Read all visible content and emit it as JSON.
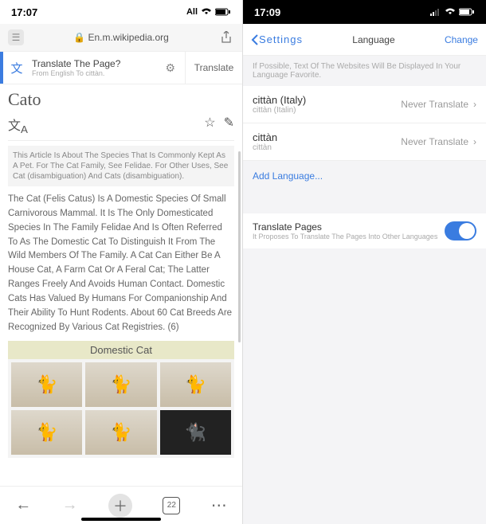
{
  "left": {
    "status": {
      "time": "17:07",
      "network": "All"
    },
    "address": {
      "lock": "🔒",
      "url": "En.m.wikipedia.org"
    },
    "translate_banner": {
      "title": "Translate The Page?",
      "subtitle": "From English To cittàn.",
      "button": "Translate"
    },
    "article": {
      "title": "Cato",
      "disambig": "This Article Is About The Species That Is Commonly Kept As A Pet. For The Cat Family, See Felidae. For Other Uses, See Cat (disambiguation) And Cats (disambiguation).",
      "body": "The Cat (Felis Catus) Is A Domestic Species Of Small Carnivorous Mammal. It Is The Only Domesticated Species In The Family Felidae And Is Often Referred To As The Domestic Cat To Distinguish It From The Wild Members Of The Family. A Cat Can Either Be A House Cat, A Farm Cat Or A Feral Cat; The Latter Ranges Freely And Avoids Human Contact. Domestic Cats Has Valued By Humans For Companionship And Their Ability To Hunt Rodents. About 60 Cat Breeds Are Recognized By Various Cat Registries. (6)",
      "infobox_header": "Domestic Cat"
    },
    "toolbar": {
      "tab_count": "22"
    }
  },
  "right": {
    "status": {
      "time": "17:09"
    },
    "nav": {
      "back": "Settings",
      "title": "Language",
      "change": "Change"
    },
    "description": "If Possible, Text Of The Websites Will Be Displayed In Your Language Favorite.",
    "languages": [
      {
        "name": "cittàn (Italy)",
        "sub": "cittàn (Italin)",
        "action": "Never Translate"
      },
      {
        "name": "cittàn",
        "sub": "cittàn",
        "action": "Never Translate"
      }
    ],
    "add_language": "Add Language...",
    "translate_pages": {
      "title": "Translate Pages",
      "subtitle": "It Proposes To Translate The Pages Into Other Languages",
      "enabled": true
    }
  }
}
